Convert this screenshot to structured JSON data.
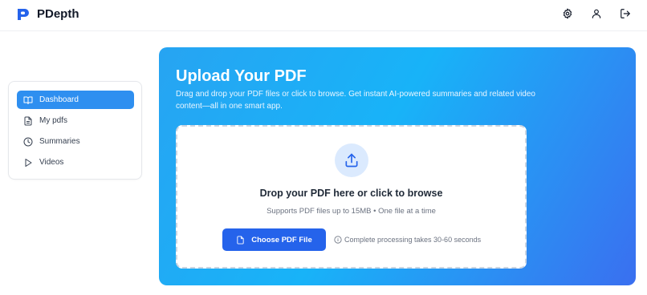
{
  "header": {
    "brand": "PDepth",
    "icons": [
      "gear-icon",
      "user-icon",
      "logout-icon"
    ]
  },
  "sidebar": {
    "items": [
      {
        "label": "Dashboard",
        "icon": "book-open-icon",
        "active": true
      },
      {
        "label": "My pdfs",
        "icon": "file-text-icon",
        "active": false
      },
      {
        "label": "Summaries",
        "icon": "clock-icon",
        "active": false
      },
      {
        "label": "Videos",
        "icon": "play-icon",
        "active": false
      }
    ]
  },
  "hero": {
    "title": "Upload Your PDF",
    "subtitle": "Drag and drop your PDF files or click to browse. Get instant AI-powered summaries and related video content—all in one smart app."
  },
  "dropzone": {
    "icon": "upload-icon",
    "title": "Drop your PDF here or click to browse",
    "subtitle": "Supports PDF files up to 15MB • One file at a time",
    "button_label": "Choose PDF File",
    "note": "Complete processing takes 30-60 seconds"
  },
  "colors": {
    "accent": "#2e8ff0",
    "button": "#2563eb",
    "gradient_start": "#27a4f2",
    "gradient_end": "#3a6ff0"
  }
}
